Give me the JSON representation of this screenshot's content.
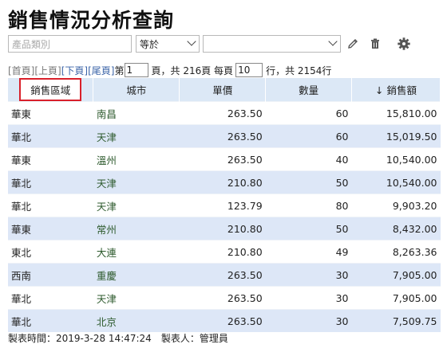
{
  "title": "銷售情況分析查詢",
  "filter": {
    "category_placeholder": "產品類別",
    "operator": "等於",
    "value": ""
  },
  "pager": {
    "first": "[首頁]",
    "prev": "[上頁]",
    "next": "[下頁]",
    "last": "[尾頁]",
    "page_prefix": "第",
    "page": "1",
    "page_suffix": "頁，共 216頁 每頁",
    "per_page": "10",
    "total_text": "行，共 2154行"
  },
  "columns": [
    "銷售區域",
    "城市",
    "單價",
    "數量",
    "↓ 銷售額"
  ],
  "rows": [
    [
      "華東",
      "南昌",
      "263.50",
      "60",
      "15,810.00"
    ],
    [
      "華北",
      "天津",
      "263.50",
      "60",
      "15,019.50"
    ],
    [
      "華東",
      "溫州",
      "263.50",
      "40",
      "10,540.00"
    ],
    [
      "華北",
      "天津",
      "210.80",
      "50",
      "10,540.00"
    ],
    [
      "華北",
      "天津",
      "123.79",
      "80",
      "9,903.20"
    ],
    [
      "華東",
      "常州",
      "210.80",
      "50",
      "8,432.00"
    ],
    [
      "東北",
      "大連",
      "210.80",
      "49",
      "8,263.36"
    ],
    [
      "西南",
      "重慶",
      "263.50",
      "30",
      "7,905.00"
    ],
    [
      "華北",
      "天津",
      "263.50",
      "30",
      "7,905.00"
    ],
    [
      "華北",
      "北京",
      "263.50",
      "30",
      "7,509.75"
    ]
  ],
  "footer": "製表時間：2019-3-28 14:47:24　製表人：管理員",
  "icons": [
    "edit-icon",
    "trash-icon",
    "gear-icon"
  ]
}
